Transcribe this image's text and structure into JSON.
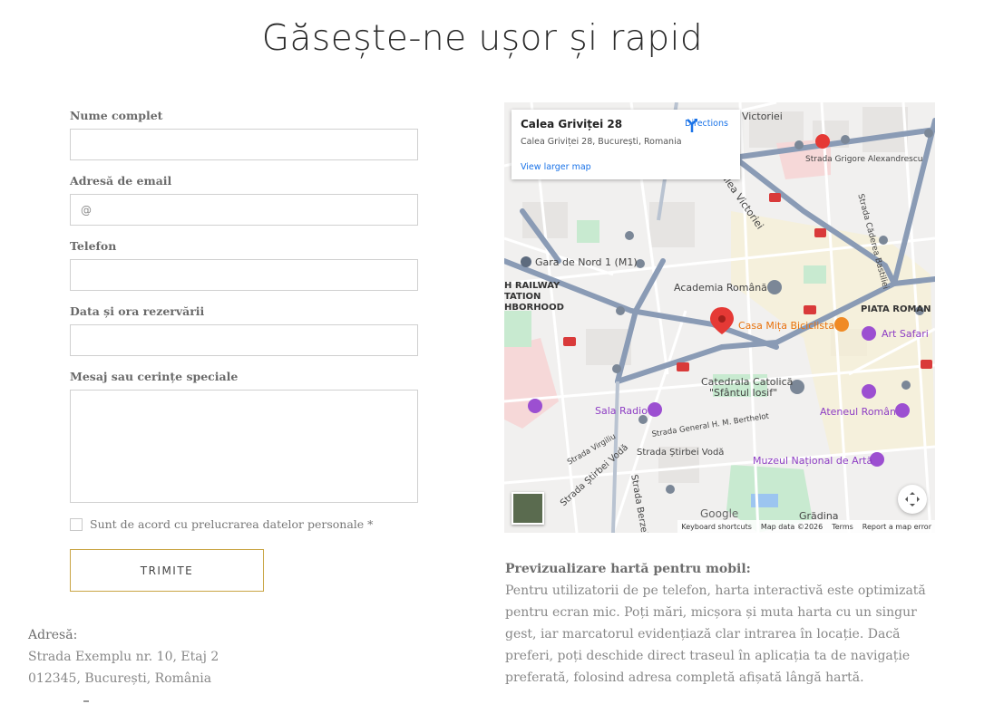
{
  "page": {
    "title": "Găsește-ne ușor și rapid"
  },
  "form": {
    "fields": [
      {
        "label": "Nume complet",
        "placeholder": ""
      },
      {
        "label": "Adresă de email",
        "placeholder": "@"
      },
      {
        "label": "Telefon",
        "placeholder": ""
      },
      {
        "label": "Data și ora rezervării",
        "placeholder": ""
      },
      {
        "label": "Mesaj sau cerințe speciale",
        "placeholder": ""
      }
    ],
    "consent_label": "Sunt de acord cu prelucrarea datelor personale *",
    "submit_label": "TRIMITE"
  },
  "address": {
    "label": "Adresă:",
    "line1": "Strada Exemplu nr. 10, Etaj 2",
    "line2": "012345, București, România"
  },
  "map": {
    "card": {
      "place": "Calea Griviței 28",
      "address": "Calea Griviței 28, București, Romania",
      "directions": "Directions",
      "larger_map": "View larger map"
    },
    "labels": {
      "victoriei": "Victoriei",
      "grigore": "Strada Grigore Alexandrescu",
      "cadrea": "Strada Căderea Bastiliei",
      "calea_victoriei": "Calea Victoriei",
      "gara": "Gara de Nord 1 (M1)",
      "railway1": "H RAILWAY",
      "railway2": "TATION",
      "railway3": "HBORHOOD",
      "academia": "Academia Română",
      "piata": "PIATA ROMAN",
      "casa": "Casa Mița Biciclista",
      "art": "Art Safari",
      "catedrala1": "Catedrala Catolică",
      "catedrala2": "\"Sfântul Iosif\"",
      "sala": "Sala Radio",
      "ateneul": "Ateneul Român",
      "berthelot": "Strada General H. M. Berthelot",
      "stirbei": "Strada Știrbei Vodă",
      "virgiliu": "Strada Virgiliu",
      "stirbei2": "Strada Știrbei Vodă",
      "berzei": "Strada Berzei",
      "muzeul": "Muzeul Național de Artă",
      "gradina": "Grădina"
    },
    "footer": {
      "shortcuts": "Keyboard shortcuts",
      "mapdata": "Map data ©2026",
      "terms": "Terms",
      "report": "Report a map error"
    },
    "google": "Google",
    "colors": {
      "road": "#8a9bb5",
      "park": "#c8ead0",
      "marker": "#e53935",
      "poi_purple": "#8e3ec4"
    }
  },
  "preview": {
    "title": "Previzualizare hartă pentru mobil:",
    "body": "Pentru utilizatorii de pe telefon, harta interactivă este optimizată pentru ecran mic. Poți mări, micșora și muta harta cu un singur gest, iar marcatorul evidențiază clar intrarea în locație. Dacă preferi, poți deschide direct traseul în aplicația ta de navigație preferată, folosind adresa completă afișată lângă hartă."
  }
}
